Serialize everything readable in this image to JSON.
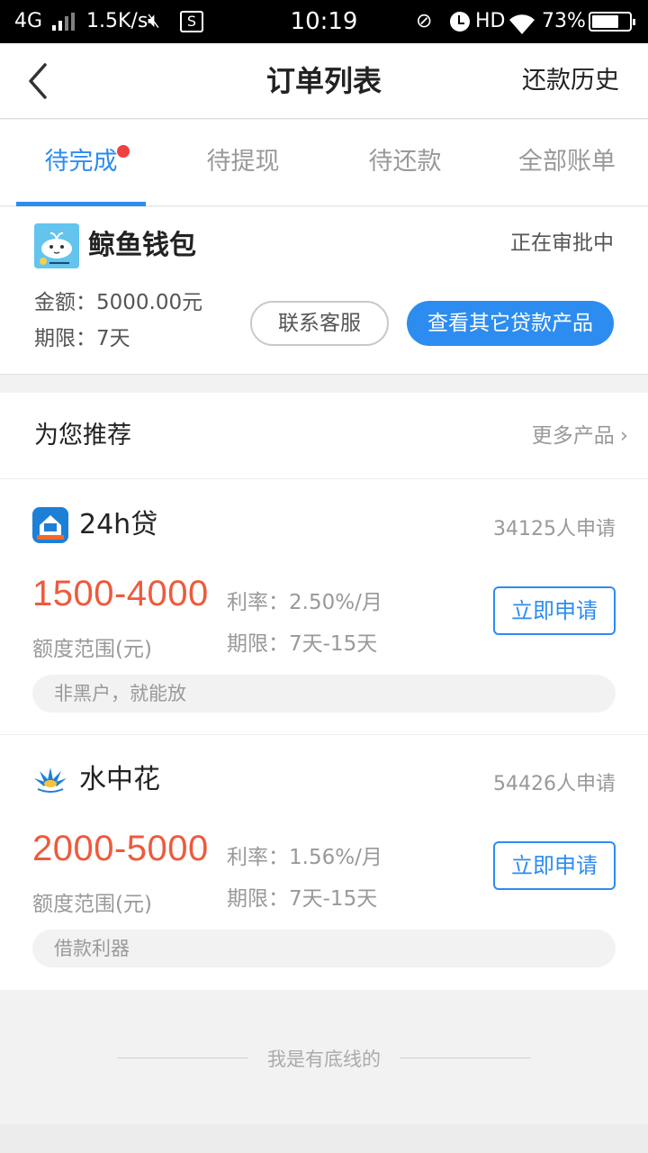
{
  "status_bar": {
    "network": "4G",
    "speed": "1.5K/s",
    "time": "10:19",
    "hd": "HD",
    "battery": "73%",
    "battery_level": 0.73
  },
  "header": {
    "title": "订单列表",
    "right_label": "还款历史"
  },
  "tabs": [
    {
      "label": "待完成",
      "active": true,
      "has_dot": true
    },
    {
      "label": "待提现",
      "active": false
    },
    {
      "label": "待还款",
      "active": false
    },
    {
      "label": "全部账单",
      "active": false
    }
  ],
  "order": {
    "name": "鲸鱼钱包",
    "status": "正在审批中",
    "amount": "金额：5000.00元",
    "term": "期限：7天",
    "btn_service": "联系客服",
    "btn_other": "查看其它贷款产品"
  },
  "recommend": {
    "title": "为您推荐",
    "more": "更多产品",
    "products": [
      {
        "name": "24h贷",
        "count": "34125人申请",
        "range": "1500-4000",
        "range_label": "额度范围(元)",
        "rate": "利率：2.50%/月",
        "term": "期限：7天-15天",
        "apply": "立即申请",
        "tag": "非黑户，就能放"
      },
      {
        "name": "水中花",
        "count": "54426人申请",
        "range": "2000-5000",
        "range_label": "额度范围(元)",
        "rate": "利率：1.56%/月",
        "term": "期限：7天-15天",
        "apply": "立即申请",
        "tag": "借款利器"
      }
    ]
  },
  "footer": {
    "text": "我是有底线的"
  },
  "colors": {
    "accent": "#2d8cf0",
    "highlight": "#ee5a3c",
    "dot": "#f04040"
  }
}
